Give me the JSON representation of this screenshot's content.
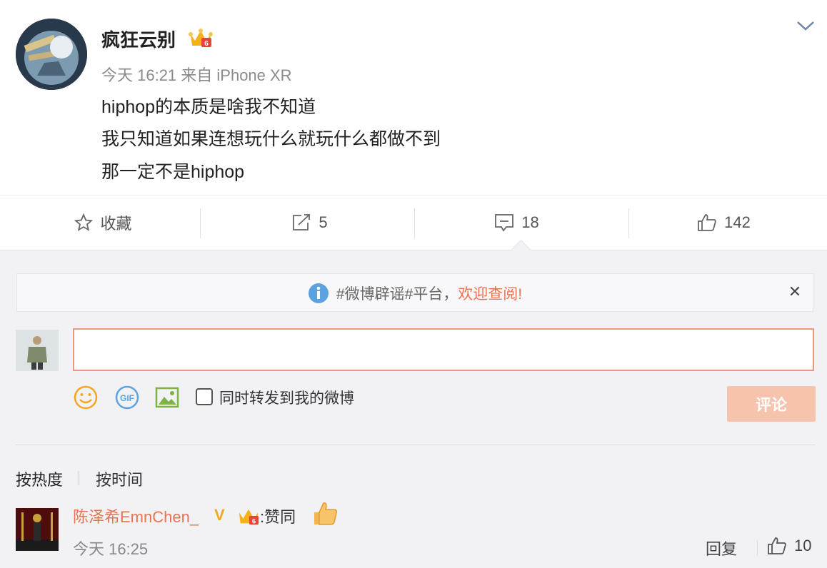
{
  "post": {
    "username": "疯狂云别",
    "meta": "今天 16:21 来自 iPhone XR",
    "lines": [
      "hiphop的本质是啥我不知道",
      "我只知道如果连想玩什么就玩什么都做不到",
      "那一定不是hiphop"
    ]
  },
  "actions": {
    "favorite": "收藏",
    "repost_count": "5",
    "comment_count": "18",
    "like_count": "142"
  },
  "notice": {
    "text": "#微博辟谣#平台，",
    "link": "欢迎查阅!"
  },
  "composer": {
    "input_value": "",
    "repost_label": "同时转发到我的微博",
    "submit_label": "评论"
  },
  "sort": {
    "hot": "按热度",
    "time": "按时间"
  },
  "comment": {
    "name": "陈泽希EmnChen_",
    "v_badge": "V",
    "colon": ":",
    "text": "赞同",
    "time": "今天 16:25",
    "reply": "回复",
    "likes": "10"
  },
  "colors": {
    "accent": "#eb7350",
    "submit_bg": "#f6c3ac",
    "notice_icon": "#5ba3e0"
  },
  "icons": [
    "star-icon",
    "repost-icon",
    "comment-icon",
    "like-icon",
    "chevron-down-icon",
    "info-icon",
    "close-icon",
    "emoji-icon",
    "gif-icon",
    "image-icon",
    "crown-badge-icon",
    "thumbs-up-emoji-icon"
  ]
}
